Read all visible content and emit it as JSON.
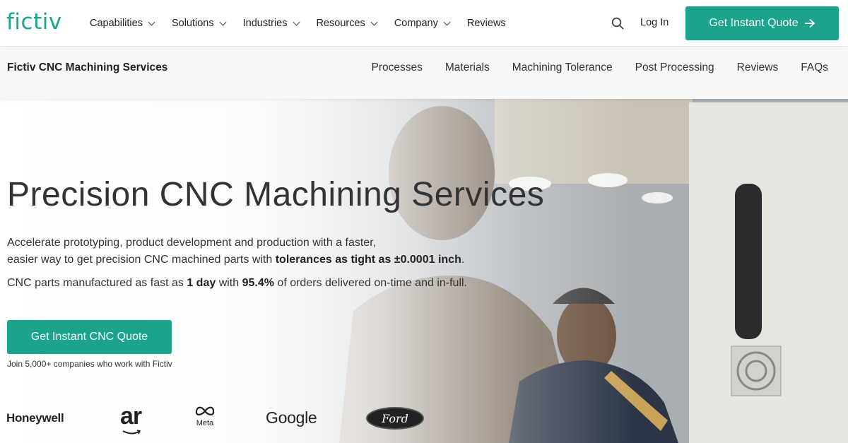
{
  "brand": {
    "logo_text": "fictiv",
    "accent": "#1ba38c"
  },
  "topnav": {
    "menu": [
      {
        "label": "Capabilities",
        "has_dropdown": true
      },
      {
        "label": "Solutions",
        "has_dropdown": true
      },
      {
        "label": "Industries",
        "has_dropdown": true
      },
      {
        "label": "Resources",
        "has_dropdown": true
      },
      {
        "label": "Company",
        "has_dropdown": true
      },
      {
        "label": "Reviews",
        "has_dropdown": false
      }
    ],
    "search_icon": "search-icon",
    "login_label": "Log In",
    "cta_label": "Get Instant Quote",
    "cta_icon": "arrow-right-icon"
  },
  "subnav": {
    "title": "Fictiv CNC Machining Services",
    "links": [
      "Processes",
      "Materials",
      "Machining Tolerance",
      "Post Processing",
      "Reviews",
      "FAQs"
    ]
  },
  "hero": {
    "title": "Precision CNC Machining Services",
    "p1_line1": "Accelerate prototyping, product development and production with a faster,",
    "p1_line2_pre": "easier way to get precision CNC machined parts with ",
    "p1_line2_bold": "tolerances as tight as ±0.0001 inch",
    "p1_line2_post": ".",
    "p2_pre": "CNC parts manufactured as fast as ",
    "p2_bold1": "1 day",
    "p2_mid": " with ",
    "p2_bold2": "95.4%",
    "p2_post": " of orders delivered on-time and in-full.",
    "cta_label": "Get Instant CNC Quote",
    "join_text": "Join 5,000+ companies who work with Fictiv"
  },
  "customer_logos": {
    "honeywell": "Honeywell",
    "ar": "ar",
    "meta": "Meta",
    "google": "Google",
    "ford": "Ford"
  }
}
